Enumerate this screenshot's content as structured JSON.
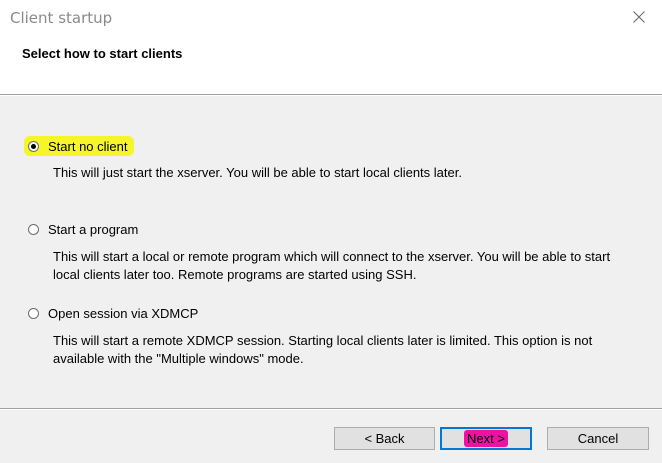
{
  "window": {
    "title": "Client startup",
    "close_icon": "close-icon"
  },
  "header": {
    "title": "Select how to start clients"
  },
  "options": [
    {
      "label": "Start no client",
      "checked": true,
      "description": "This will just start the xserver. You will be able to start local clients later."
    },
    {
      "label": "Start a program",
      "checked": false,
      "description": "This will start a local or remote program which will connect to the xserver. You will be able to start local clients later too. Remote programs are started using SSH."
    },
    {
      "label": "Open session via XDMCP",
      "checked": false,
      "description": "This will start a remote XDMCP session. Starting local clients later is limited. This option is not available with the \"Multiple windows\" mode."
    }
  ],
  "buttons": {
    "back": "< Back",
    "next": "Next >",
    "cancel": "Cancel"
  },
  "colors": {
    "highlight_yellow": "#f5f52a",
    "highlight_magenta": "#ef10a4",
    "focus_blue": "#0078d7"
  }
}
